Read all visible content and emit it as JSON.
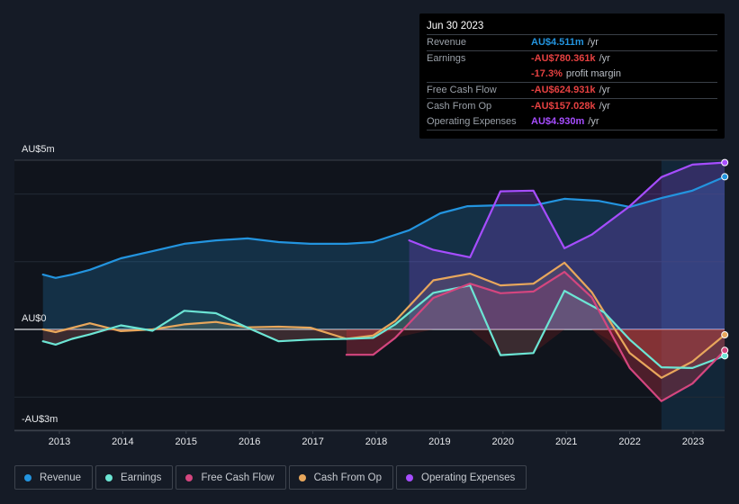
{
  "tooltip": {
    "date": "Jun 30 2023",
    "rows": [
      {
        "label": "Revenue",
        "value": "AU$4.511m",
        "unit": "/yr",
        "color": "#2394df"
      },
      {
        "label": "Earnings",
        "value": "-AU$780.361k",
        "unit": "/yr",
        "color": "#e64141"
      },
      {
        "label": "",
        "value": "-17.3%",
        "unit": "profit margin",
        "color": "#e64141"
      },
      {
        "label": "Free Cash Flow",
        "value": "-AU$624.931k",
        "unit": "/yr",
        "color": "#e64141"
      },
      {
        "label": "Cash From Op",
        "value": "-AU$157.028k",
        "unit": "/yr",
        "color": "#e64141"
      },
      {
        "label": "Operating Expenses",
        "value": "AU$4.930m",
        "unit": "/yr",
        "color": "#a64dff"
      }
    ]
  },
  "legend": [
    {
      "label": "Revenue",
      "color": "#2394df"
    },
    {
      "label": "Earnings",
      "color": "#6ce5d4"
    },
    {
      "label": "Free Cash Flow",
      "color": "#d4467f"
    },
    {
      "label": "Cash From Op",
      "color": "#e8a75c"
    },
    {
      "label": "Operating Expenses",
      "color": "#a64dff"
    }
  ],
  "chart_data": {
    "type": "line",
    "title": "",
    "xlabel": "",
    "ylabel": "",
    "currency_unit": "AU$ millions",
    "ylim": [
      -3,
      5
    ],
    "y_tick_labels": [
      {
        "value": 5,
        "label": "AU$5m"
      },
      {
        "value": 0,
        "label": "AU$0"
      },
      {
        "value": -3,
        "label": "-AU$3m"
      }
    ],
    "gridlines": [
      5,
      4,
      2,
      0,
      -2,
      -3
    ],
    "x_range": [
      2012.3,
      2023.5
    ],
    "x_tick_labels": [
      "2013",
      "2014",
      "2015",
      "2016",
      "2017",
      "2018",
      "2019",
      "2020",
      "2021",
      "2022",
      "2023"
    ],
    "highlight_region": [
      2022.5,
      2023.5
    ],
    "series": [
      {
        "name": "Revenue",
        "color": "#2394df",
        "points": [
          [
            2012.74,
            1.62
          ],
          [
            2012.94,
            1.52
          ],
          [
            2013.2,
            1.62
          ],
          [
            2013.48,
            1.76
          ],
          [
            2013.97,
            2.1
          ],
          [
            2014.47,
            2.31
          ],
          [
            2014.97,
            2.53
          ],
          [
            2015.47,
            2.63
          ],
          [
            2015.97,
            2.69
          ],
          [
            2016.46,
            2.58
          ],
          [
            2016.96,
            2.53
          ],
          [
            2017.53,
            2.53
          ],
          [
            2017.95,
            2.58
          ],
          [
            2018.52,
            2.93
          ],
          [
            2019.01,
            3.43
          ],
          [
            2019.44,
            3.64
          ],
          [
            2020.0,
            3.67
          ],
          [
            2020.5,
            3.67
          ],
          [
            2020.97,
            3.86
          ],
          [
            2021.5,
            3.8
          ],
          [
            2022.0,
            3.62
          ],
          [
            2022.5,
            3.88
          ],
          [
            2022.99,
            4.1
          ],
          [
            2023.5,
            4.51
          ]
        ]
      },
      {
        "name": "Earnings",
        "color": "#6ce5d4",
        "points": [
          [
            2012.74,
            -0.35
          ],
          [
            2012.94,
            -0.45
          ],
          [
            2013.2,
            -0.28
          ],
          [
            2013.48,
            -0.15
          ],
          [
            2013.97,
            0.12
          ],
          [
            2014.47,
            -0.04
          ],
          [
            2014.97,
            0.55
          ],
          [
            2015.47,
            0.48
          ],
          [
            2015.97,
            0.05
          ],
          [
            2016.46,
            -0.35
          ],
          [
            2016.96,
            -0.3
          ],
          [
            2017.53,
            -0.28
          ],
          [
            2017.95,
            -0.25
          ],
          [
            2018.3,
            0.15
          ],
          [
            2018.9,
            1.08
          ],
          [
            2019.48,
            1.3
          ],
          [
            2019.96,
            -0.76
          ],
          [
            2020.48,
            -0.7
          ],
          [
            2020.97,
            1.14
          ],
          [
            2021.3,
            0.8
          ],
          [
            2021.6,
            0.5
          ],
          [
            2022.0,
            -0.3
          ],
          [
            2022.5,
            -1.12
          ],
          [
            2022.99,
            -1.14
          ],
          [
            2023.5,
            -0.78
          ]
        ]
      },
      {
        "name": "Free Cash Flow",
        "color": "#d4467f",
        "points": [
          [
            2017.53,
            -0.75
          ],
          [
            2017.95,
            -0.75
          ],
          [
            2018.3,
            -0.25
          ],
          [
            2018.9,
            0.93
          ],
          [
            2019.48,
            1.35
          ],
          [
            2019.96,
            1.07
          ],
          [
            2020.48,
            1.12
          ],
          [
            2020.97,
            1.7
          ],
          [
            2021.4,
            0.95
          ],
          [
            2022.0,
            -1.14
          ],
          [
            2022.5,
            -2.12
          ],
          [
            2022.99,
            -1.6
          ],
          [
            2023.5,
            -0.62
          ]
        ]
      },
      {
        "name": "Cash From Op",
        "color": "#e8a75c",
        "points": [
          [
            2012.74,
            0.0
          ],
          [
            2012.94,
            -0.08
          ],
          [
            2013.48,
            0.18
          ],
          [
            2013.97,
            -0.05
          ],
          [
            2014.47,
            0.0
          ],
          [
            2014.97,
            0.15
          ],
          [
            2015.47,
            0.22
          ],
          [
            2015.97,
            0.06
          ],
          [
            2016.46,
            0.08
          ],
          [
            2016.96,
            0.05
          ],
          [
            2017.53,
            -0.28
          ],
          [
            2017.95,
            -0.18
          ],
          [
            2018.3,
            0.25
          ],
          [
            2018.9,
            1.45
          ],
          [
            2019.48,
            1.65
          ],
          [
            2019.96,
            1.3
          ],
          [
            2020.48,
            1.35
          ],
          [
            2020.97,
            1.97
          ],
          [
            2021.4,
            1.1
          ],
          [
            2022.0,
            -0.7
          ],
          [
            2022.5,
            -1.43
          ],
          [
            2022.99,
            -0.95
          ],
          [
            2023.5,
            -0.16
          ]
        ]
      },
      {
        "name": "Operating Expenses",
        "color": "#a64dff",
        "points": [
          [
            2018.52,
            2.63
          ],
          [
            2018.9,
            2.35
          ],
          [
            2019.48,
            2.13
          ],
          [
            2019.96,
            4.08
          ],
          [
            2020.48,
            4.1
          ],
          [
            2020.97,
            2.4
          ],
          [
            2021.4,
            2.8
          ],
          [
            2022.0,
            3.64
          ],
          [
            2022.5,
            4.5
          ],
          [
            2022.99,
            4.87
          ],
          [
            2023.5,
            4.93
          ]
        ]
      }
    ]
  }
}
